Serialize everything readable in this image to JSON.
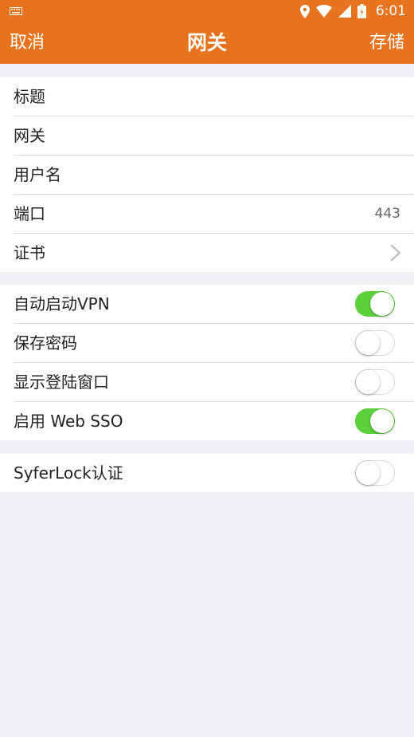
{
  "status_bar": {
    "time": "6:01",
    "icons": [
      "keyboard-icon",
      "location-icon",
      "wifi-icon",
      "signal-icon",
      "battery-icon"
    ]
  },
  "nav": {
    "cancel_label": "取消",
    "title": "网关",
    "save_label": "存储"
  },
  "colors": {
    "accent": "#e8731e",
    "toggle_on": "#5cd03c",
    "background": "#efeff4"
  },
  "section1": {
    "rows": [
      {
        "label": "标题"
      },
      {
        "label": "网关"
      },
      {
        "label": "用户名"
      },
      {
        "label": "端口",
        "value": "443"
      },
      {
        "label": "证书"
      }
    ]
  },
  "section2": {
    "rows": [
      {
        "label": "自动启动VPN",
        "on": true
      },
      {
        "label": "保存密码",
        "on": false
      },
      {
        "label": "显示登陆窗口",
        "on": false
      },
      {
        "label": "启用 Web SSO",
        "on": true
      }
    ]
  },
  "section3": {
    "rows": [
      {
        "label": "SyferLock认证",
        "on": false
      }
    ]
  }
}
